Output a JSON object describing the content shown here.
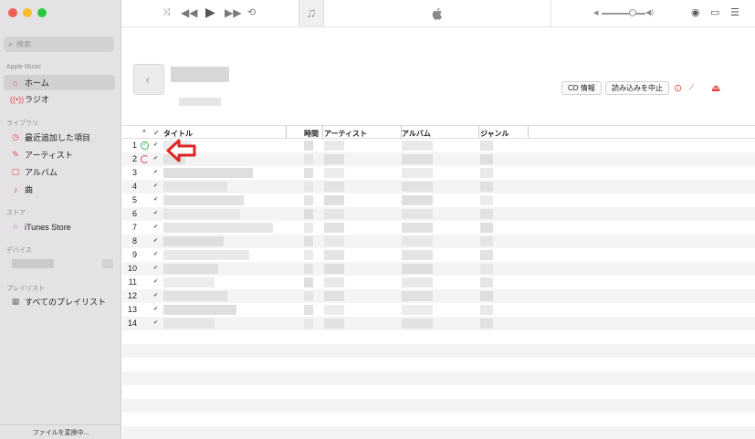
{
  "window": {
    "traffic_colors": [
      "#ec5f57",
      "#f6be2f",
      "#2ac840"
    ]
  },
  "toolbar": {
    "shuffle_icon": "shuffle-icon",
    "previous_icon": "previous-icon",
    "play_icon": "play-icon",
    "next_icon": "next-icon",
    "repeat_icon": "repeat-icon",
    "music_note_icon": "music-note-icon",
    "apple_logo": "apple-logo-icon",
    "volume_level": 0.6,
    "right_icons": [
      "airplay-icon",
      "lyrics-icon",
      "queue-list-icon"
    ]
  },
  "sidebar": {
    "search_placeholder": "検索",
    "sections": {
      "apple_music": "Apple Music",
      "library": "ライブラリ",
      "store": "ストア",
      "devices": "デバイス",
      "playlists": "プレイリスト"
    },
    "apple_music_items": [
      {
        "label": "ホーム",
        "icon": "home-icon",
        "selected": true
      },
      {
        "label": "ラジオ",
        "icon": "radio-icon",
        "selected": false
      }
    ],
    "library_items": [
      {
        "label": "最近追加した項目",
        "icon": "clock-icon"
      },
      {
        "label": "アーティスト",
        "icon": "microphone-icon"
      },
      {
        "label": "アルバム",
        "icon": "album-icon"
      },
      {
        "label": "曲",
        "icon": "music-note-icon"
      }
    ],
    "store_items": [
      {
        "label": "iTunes Store",
        "icon": "star-icon"
      }
    ],
    "playlist_items": [
      {
        "label": "すべてのプレイリスト",
        "icon": "grid-icon"
      }
    ],
    "footer": "ファイルを変換中..."
  },
  "album_header": {
    "buttons": {
      "cd_info": "CD 情報",
      "stop_import": "読み込みを中止"
    },
    "icons": [
      "import-status-icon",
      "edit-icon",
      "eject-icon"
    ]
  },
  "table": {
    "headers": {
      "sort": "^",
      "check": "✓",
      "title": "タイトル",
      "time": "時間",
      "artist": "アーティスト",
      "album": "アルバム",
      "genre": "ジャンル"
    },
    "rows": [
      {
        "num": "1",
        "status": "done"
      },
      {
        "num": "2",
        "status": "importing"
      },
      {
        "num": "3",
        "status": ""
      },
      {
        "num": "4",
        "status": ""
      },
      {
        "num": "5",
        "status": ""
      },
      {
        "num": "6",
        "status": ""
      },
      {
        "num": "7",
        "status": ""
      },
      {
        "num": "8",
        "status": ""
      },
      {
        "num": "9",
        "status": ""
      },
      {
        "num": "10",
        "status": ""
      },
      {
        "num": "11",
        "status": ""
      },
      {
        "num": "12",
        "status": ""
      },
      {
        "num": "13",
        "status": ""
      },
      {
        "num": "14",
        "status": ""
      }
    ],
    "annotation_color": "#e02424"
  }
}
